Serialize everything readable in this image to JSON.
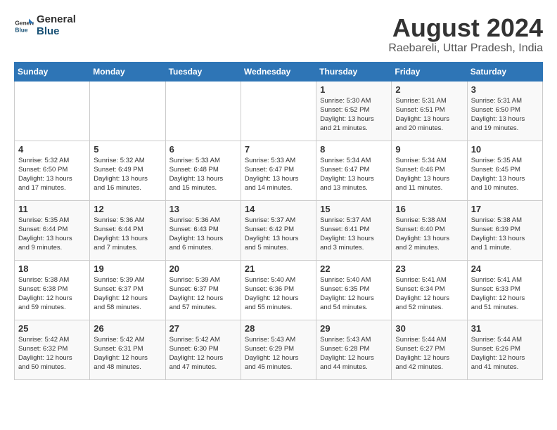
{
  "header": {
    "logo_general": "General",
    "logo_blue": "Blue",
    "month_year": "August 2024",
    "location": "Raebareli, Uttar Pradesh, India"
  },
  "weekdays": [
    "Sunday",
    "Monday",
    "Tuesday",
    "Wednesday",
    "Thursday",
    "Friday",
    "Saturday"
  ],
  "weeks": [
    [
      {
        "day": "",
        "info": ""
      },
      {
        "day": "",
        "info": ""
      },
      {
        "day": "",
        "info": ""
      },
      {
        "day": "",
        "info": ""
      },
      {
        "day": "1",
        "info": "Sunrise: 5:30 AM\nSunset: 6:52 PM\nDaylight: 13 hours\nand 21 minutes."
      },
      {
        "day": "2",
        "info": "Sunrise: 5:31 AM\nSunset: 6:51 PM\nDaylight: 13 hours\nand 20 minutes."
      },
      {
        "day": "3",
        "info": "Sunrise: 5:31 AM\nSunset: 6:50 PM\nDaylight: 13 hours\nand 19 minutes."
      }
    ],
    [
      {
        "day": "4",
        "info": "Sunrise: 5:32 AM\nSunset: 6:50 PM\nDaylight: 13 hours\nand 17 minutes."
      },
      {
        "day": "5",
        "info": "Sunrise: 5:32 AM\nSunset: 6:49 PM\nDaylight: 13 hours\nand 16 minutes."
      },
      {
        "day": "6",
        "info": "Sunrise: 5:33 AM\nSunset: 6:48 PM\nDaylight: 13 hours\nand 15 minutes."
      },
      {
        "day": "7",
        "info": "Sunrise: 5:33 AM\nSunset: 6:47 PM\nDaylight: 13 hours\nand 14 minutes."
      },
      {
        "day": "8",
        "info": "Sunrise: 5:34 AM\nSunset: 6:47 PM\nDaylight: 13 hours\nand 13 minutes."
      },
      {
        "day": "9",
        "info": "Sunrise: 5:34 AM\nSunset: 6:46 PM\nDaylight: 13 hours\nand 11 minutes."
      },
      {
        "day": "10",
        "info": "Sunrise: 5:35 AM\nSunset: 6:45 PM\nDaylight: 13 hours\nand 10 minutes."
      }
    ],
    [
      {
        "day": "11",
        "info": "Sunrise: 5:35 AM\nSunset: 6:44 PM\nDaylight: 13 hours\nand 9 minutes."
      },
      {
        "day": "12",
        "info": "Sunrise: 5:36 AM\nSunset: 6:44 PM\nDaylight: 13 hours\nand 7 minutes."
      },
      {
        "day": "13",
        "info": "Sunrise: 5:36 AM\nSunset: 6:43 PM\nDaylight: 13 hours\nand 6 minutes."
      },
      {
        "day": "14",
        "info": "Sunrise: 5:37 AM\nSunset: 6:42 PM\nDaylight: 13 hours\nand 5 minutes."
      },
      {
        "day": "15",
        "info": "Sunrise: 5:37 AM\nSunset: 6:41 PM\nDaylight: 13 hours\nand 3 minutes."
      },
      {
        "day": "16",
        "info": "Sunrise: 5:38 AM\nSunset: 6:40 PM\nDaylight: 13 hours\nand 2 minutes."
      },
      {
        "day": "17",
        "info": "Sunrise: 5:38 AM\nSunset: 6:39 PM\nDaylight: 13 hours\nand 1 minute."
      }
    ],
    [
      {
        "day": "18",
        "info": "Sunrise: 5:38 AM\nSunset: 6:38 PM\nDaylight: 12 hours\nand 59 minutes."
      },
      {
        "day": "19",
        "info": "Sunrise: 5:39 AM\nSunset: 6:37 PM\nDaylight: 12 hours\nand 58 minutes."
      },
      {
        "day": "20",
        "info": "Sunrise: 5:39 AM\nSunset: 6:37 PM\nDaylight: 12 hours\nand 57 minutes."
      },
      {
        "day": "21",
        "info": "Sunrise: 5:40 AM\nSunset: 6:36 PM\nDaylight: 12 hours\nand 55 minutes."
      },
      {
        "day": "22",
        "info": "Sunrise: 5:40 AM\nSunset: 6:35 PM\nDaylight: 12 hours\nand 54 minutes."
      },
      {
        "day": "23",
        "info": "Sunrise: 5:41 AM\nSunset: 6:34 PM\nDaylight: 12 hours\nand 52 minutes."
      },
      {
        "day": "24",
        "info": "Sunrise: 5:41 AM\nSunset: 6:33 PM\nDaylight: 12 hours\nand 51 minutes."
      }
    ],
    [
      {
        "day": "25",
        "info": "Sunrise: 5:42 AM\nSunset: 6:32 PM\nDaylight: 12 hours\nand 50 minutes."
      },
      {
        "day": "26",
        "info": "Sunrise: 5:42 AM\nSunset: 6:31 PM\nDaylight: 12 hours\nand 48 minutes."
      },
      {
        "day": "27",
        "info": "Sunrise: 5:42 AM\nSunset: 6:30 PM\nDaylight: 12 hours\nand 47 minutes."
      },
      {
        "day": "28",
        "info": "Sunrise: 5:43 AM\nSunset: 6:29 PM\nDaylight: 12 hours\nand 45 minutes."
      },
      {
        "day": "29",
        "info": "Sunrise: 5:43 AM\nSunset: 6:28 PM\nDaylight: 12 hours\nand 44 minutes."
      },
      {
        "day": "30",
        "info": "Sunrise: 5:44 AM\nSunset: 6:27 PM\nDaylight: 12 hours\nand 42 minutes."
      },
      {
        "day": "31",
        "info": "Sunrise: 5:44 AM\nSunset: 6:26 PM\nDaylight: 12 hours\nand 41 minutes."
      }
    ]
  ]
}
